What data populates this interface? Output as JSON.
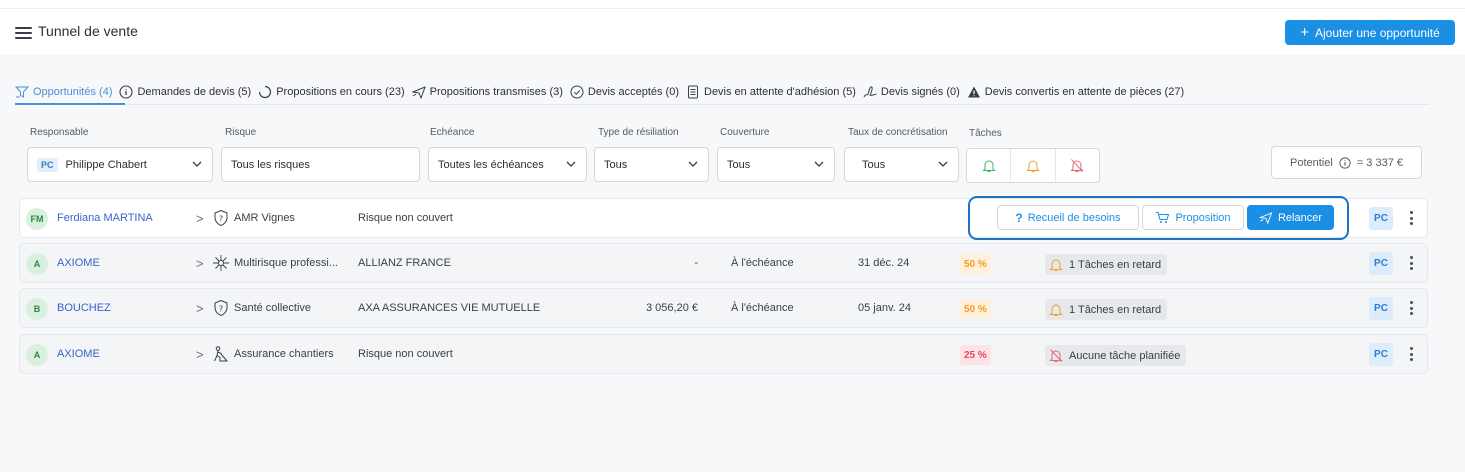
{
  "header": {
    "title": "Tunnel de vente",
    "add_button_label": "Ajouter une opportunité"
  },
  "tabs": [
    {
      "label": "Opportunités (4)",
      "icon": "funnel-icon",
      "active": true
    },
    {
      "label": "Demandes de devis (5)",
      "icon": "info-circle-icon"
    },
    {
      "label": "Propositions en cours (23)",
      "icon": "spinner-icon"
    },
    {
      "label": "Propositions transmises (3)",
      "icon": "send-icon"
    },
    {
      "label": "Devis acceptés (0)",
      "icon": "check-circle-icon"
    },
    {
      "label": "Devis en attente d'adhésion (5)",
      "icon": "document-icon"
    },
    {
      "label": "Devis signés (0)",
      "icon": "signature-icon"
    },
    {
      "label": "Devis convertis en attente de pièces (27)",
      "icon": "warning-triangle-icon"
    }
  ],
  "filters": {
    "responsable": {
      "label": "Responsable",
      "initials": "PC",
      "value": "Philippe Chabert"
    },
    "risque": {
      "label": "Risque",
      "value": "Tous les risques"
    },
    "echeance": {
      "label": "Echéance",
      "value": "Toutes les échéances"
    },
    "resiliation": {
      "label": "Type de résiliation",
      "value": "Tous"
    },
    "couverture": {
      "label": "Couverture",
      "value": "Tous"
    },
    "taux": {
      "label": "Taux de concrétisation",
      "value": "Tous"
    },
    "taches": {
      "label": "Tâches"
    },
    "potentiel": {
      "label": "Potentiel",
      "value": "= 3 337 €"
    }
  },
  "actions": {
    "recueil": "Recueil de besoins",
    "proposition": "Proposition",
    "relancer": "Relancer"
  },
  "rows": [
    {
      "initials": "FM",
      "name": "Ferdiana MARTINA",
      "product": "AMR Vignes",
      "insurer": "Risque non couvert",
      "amount": "",
      "term": "",
      "date": "",
      "pct": "",
      "task": "",
      "owner": "PC"
    },
    {
      "initials": "A",
      "name": "AXIOME",
      "product": "Multirisque professi...",
      "insurer": "ALLIANZ FRANCE",
      "amount": "-",
      "term": "À l'échéance",
      "date": "31 déc. 24",
      "pct": "50 %",
      "task": "1 Tâches en retard",
      "owner": "PC"
    },
    {
      "initials": "B",
      "name": "BOUCHEZ",
      "product": "Santé collective",
      "insurer": "AXA ASSURANCES VIE MUTUELLE",
      "amount": "3 056,20 €",
      "term": "À l'échéance",
      "date": "05 janv. 24",
      "pct": "50 %",
      "task": "1 Tâches en retard",
      "owner": "PC"
    },
    {
      "initials": "A",
      "name": "AXIOME",
      "product": "Assurance chantiers",
      "insurer": "Risque non couvert",
      "amount": "",
      "term": "",
      "date": "",
      "pct": "25 %",
      "task": "Aucune tâche planifiée",
      "owner": "PC"
    }
  ],
  "colors": {
    "accent": "#1a8fe3",
    "highlight_frame": "#1d72c4",
    "pct_orange": "#f39b2a",
    "pct_red": "#e04860"
  }
}
